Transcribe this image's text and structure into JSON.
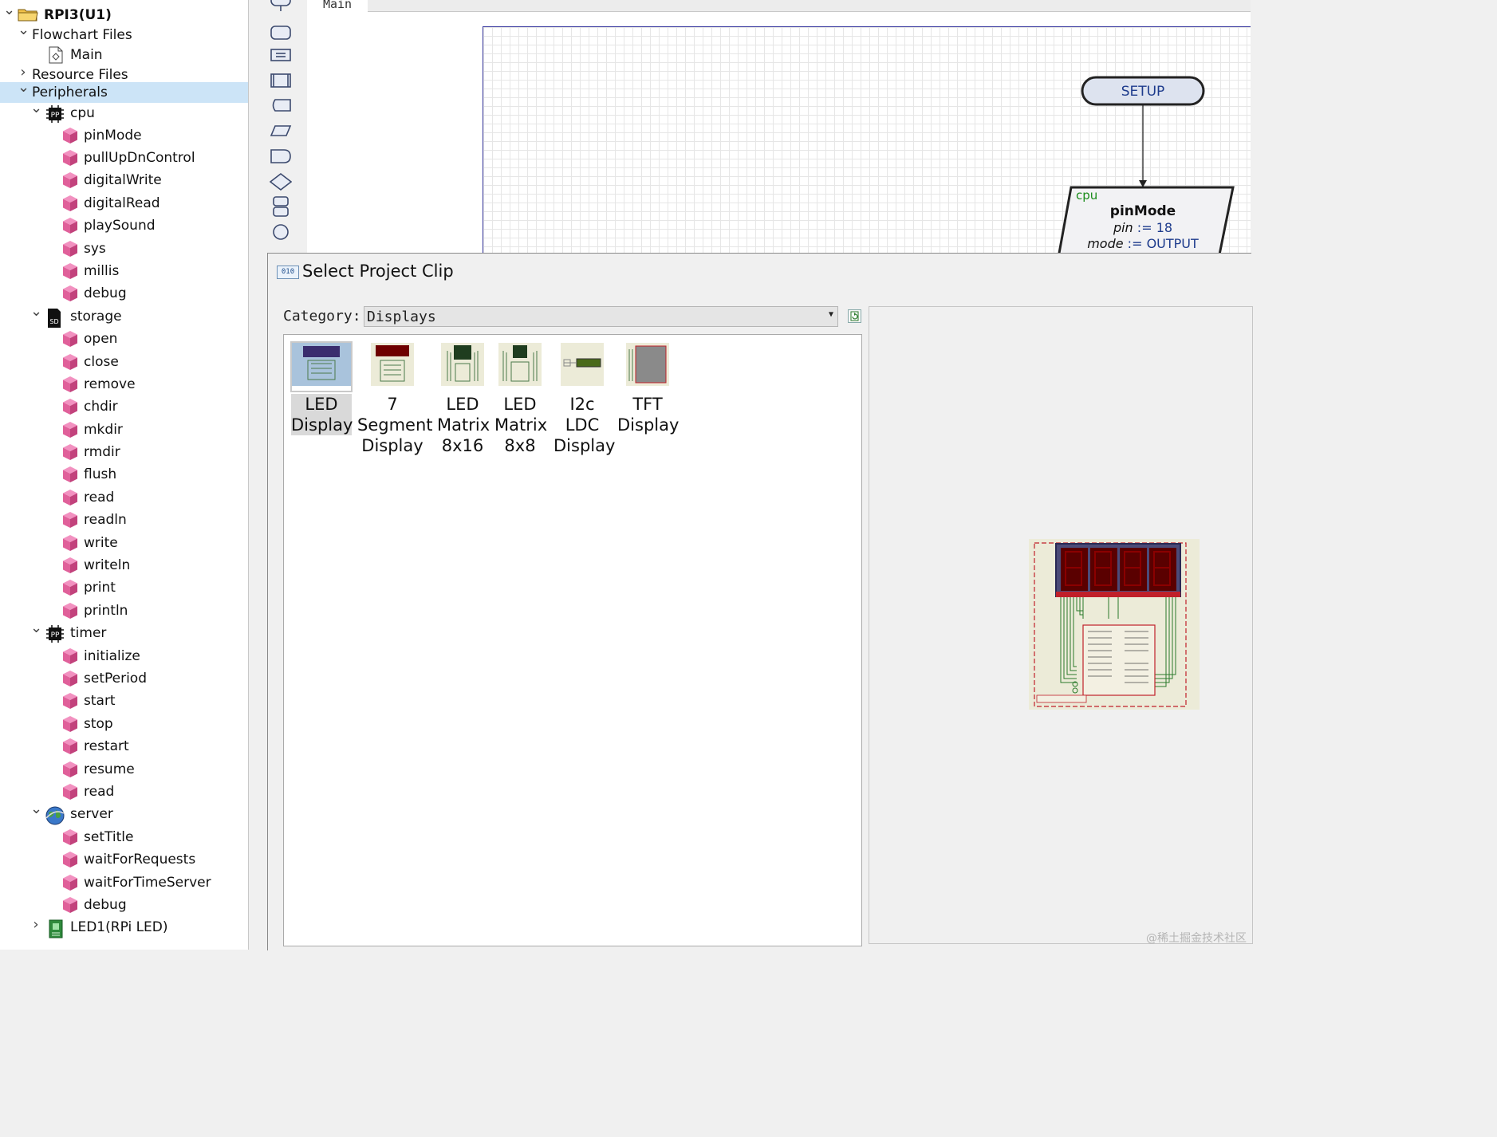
{
  "tree": {
    "items": [
      {
        "label": "RPI3(U1)",
        "expanded": true,
        "icon": "folder-icon"
      },
      {
        "label": "Flowchart Files",
        "expanded": true
      },
      {
        "label": "Main",
        "icon": "flowchart-file-icon"
      },
      {
        "label": "Resource Files",
        "expanded": false
      },
      {
        "label": "Peripherals",
        "expanded": true,
        "selected": true
      },
      {
        "label": "cpu",
        "expanded": true,
        "icon": "chip-icon"
      },
      {
        "label": "pinMode"
      },
      {
        "label": "pullUpDnControl"
      },
      {
        "label": "digitalWrite"
      },
      {
        "label": "digitalRead"
      },
      {
        "label": "playSound"
      },
      {
        "label": "sys"
      },
      {
        "label": "millis"
      },
      {
        "label": "debug"
      },
      {
        "label": "storage",
        "expanded": true,
        "icon": "sd-card-icon"
      },
      {
        "label": "open"
      },
      {
        "label": "close"
      },
      {
        "label": "remove"
      },
      {
        "label": "chdir"
      },
      {
        "label": "mkdir"
      },
      {
        "label": "rmdir"
      },
      {
        "label": "flush"
      },
      {
        "label": "read"
      },
      {
        "label": "readln"
      },
      {
        "label": "write"
      },
      {
        "label": "writeln"
      },
      {
        "label": "print"
      },
      {
        "label": "println"
      },
      {
        "label": "timer",
        "expanded": true,
        "icon": "chip-icon"
      },
      {
        "label": "initialize"
      },
      {
        "label": "setPeriod"
      },
      {
        "label": "start"
      },
      {
        "label": "stop"
      },
      {
        "label": "restart"
      },
      {
        "label": "resume"
      },
      {
        "label": "read"
      },
      {
        "label": "server",
        "expanded": true,
        "icon": "globe-icon"
      },
      {
        "label": "setTitle"
      },
      {
        "label": "waitForRequests"
      },
      {
        "label": "waitForTimeServer"
      },
      {
        "label": "debug"
      },
      {
        "label": "LED1(RPi LED)",
        "expanded": false,
        "icon": "led-board-icon"
      }
    ]
  },
  "editor": {
    "tab_label": "Main",
    "setup_label": "SETUP",
    "block": {
      "peripheral": "cpu",
      "method": "pinMode",
      "arg1_name": "pin",
      "arg1_op": ":=",
      "arg1_value": "18",
      "arg2_name": "mode",
      "arg2_op": ":=",
      "arg2_value": "OUTPUT"
    }
  },
  "dialog": {
    "title": "Select Project Clip",
    "icon_text": "010",
    "category_label": "Category:",
    "category_value": "Displays",
    "clips": [
      {
        "lines": [
          "LED",
          "Display"
        ],
        "selected": true
      },
      {
        "lines": [
          "7",
          "Segment",
          "Display"
        ]
      },
      {
        "lines": [
          "LED",
          "Matrix",
          "8x16"
        ]
      },
      {
        "lines": [
          "LED",
          "Matrix",
          "8x8"
        ]
      },
      {
        "lines": [
          "I2c",
          "LDC",
          "Display"
        ]
      },
      {
        "lines": [
          "TFT",
          "Display"
        ]
      }
    ]
  },
  "watermark": "@稀土掘金技术社区",
  "colors": {
    "tree_selection": "#cce4f7",
    "cube": "#e0609a",
    "setup_fill": "#dde3ef",
    "setup_text": "#1d3b8c",
    "keyword_green": "#1a8c1a",
    "value_blue": "#1d3b8c",
    "segment_red": "#6e0000"
  }
}
